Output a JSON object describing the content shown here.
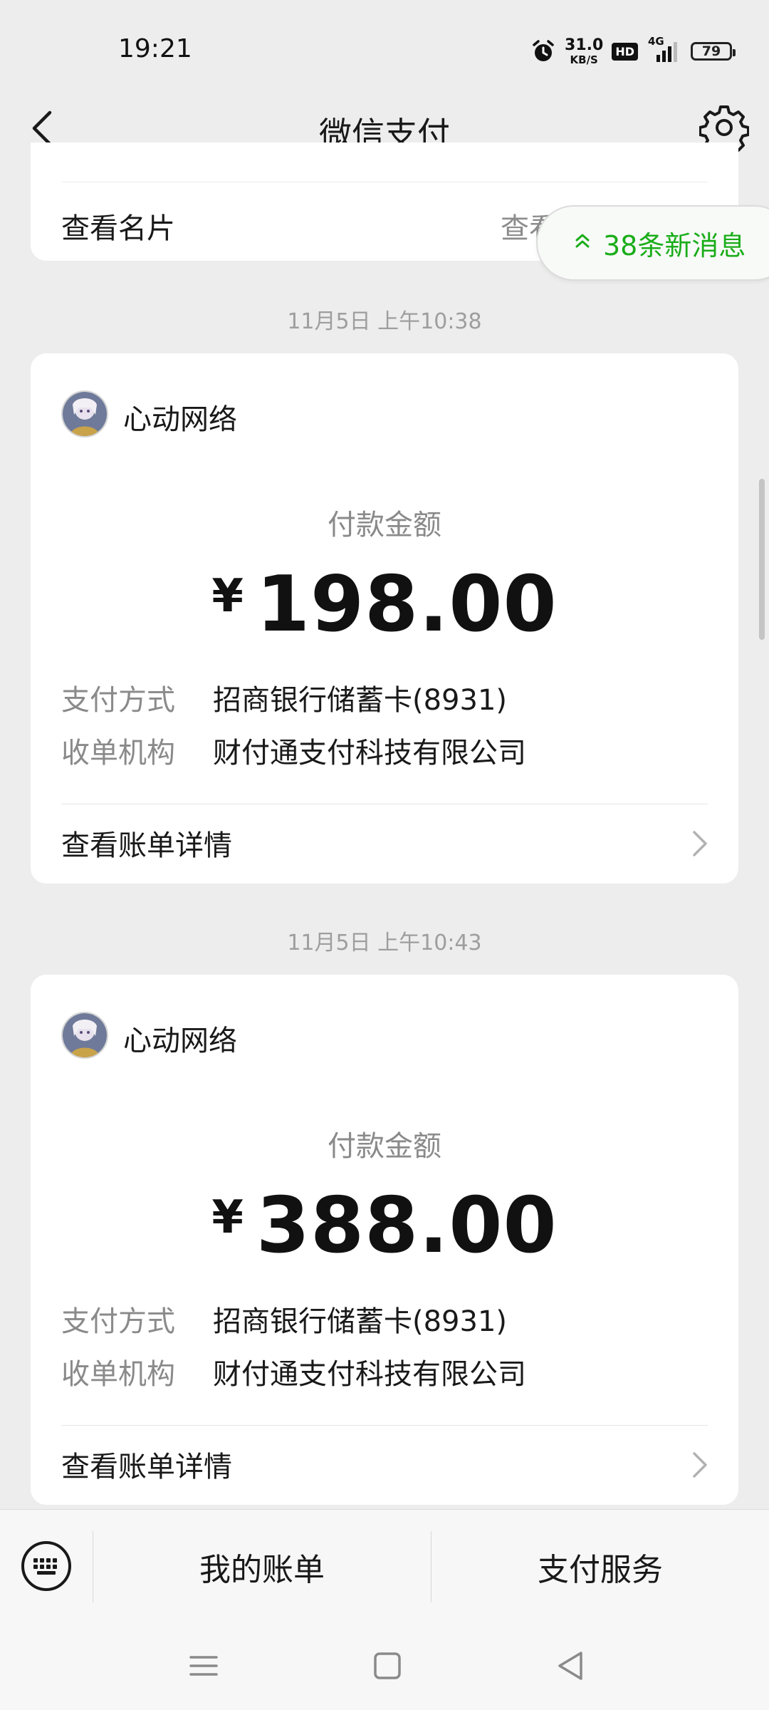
{
  "status_bar": {
    "time": "19:21",
    "net_speed_value": "31.0",
    "net_speed_unit": "KB/S",
    "hd_badge": "HD",
    "network_type": "4G",
    "battery": "79"
  },
  "header": {
    "title": "微信支付",
    "back_icon": "chevron-left-icon",
    "settings_icon": "gear-icon"
  },
  "top_card": {
    "label": "查看名片",
    "value": "查看"
  },
  "new_messages": {
    "label": "38条新消息",
    "icon": "double-chevron-up-icon"
  },
  "payments": [
    {
      "timestamp": "11月5日 上午10:38",
      "merchant": "心动网络",
      "amount_label": "付款金额",
      "currency": "¥",
      "amount": "198.00",
      "method_label": "支付方式",
      "method_value": "招商银行储蓄卡(8931)",
      "acquirer_label": "收单机构",
      "acquirer_value": "财付通支付科技有限公司",
      "detail_link": "查看账单详情"
    },
    {
      "timestamp": "11月5日 上午10:43",
      "merchant": "心动网络",
      "amount_label": "付款金额",
      "currency": "¥",
      "amount": "388.00",
      "method_label": "支付方式",
      "method_value": "招商银行储蓄卡(8931)",
      "acquirer_label": "收单机构",
      "acquirer_value": "财付通支付科技有限公司",
      "detail_link": "查看账单详情"
    }
  ],
  "bottom_menu": {
    "keyboard_icon": "keyboard-icon",
    "items": [
      "我的账单",
      "支付服务"
    ]
  },
  "nav_bar": {
    "icons": [
      "menu-icon",
      "home-square-icon",
      "back-triangle-icon"
    ]
  },
  "colors": {
    "accent_green": "#1aad19",
    "background": "#ededed",
    "card": "#ffffff"
  }
}
